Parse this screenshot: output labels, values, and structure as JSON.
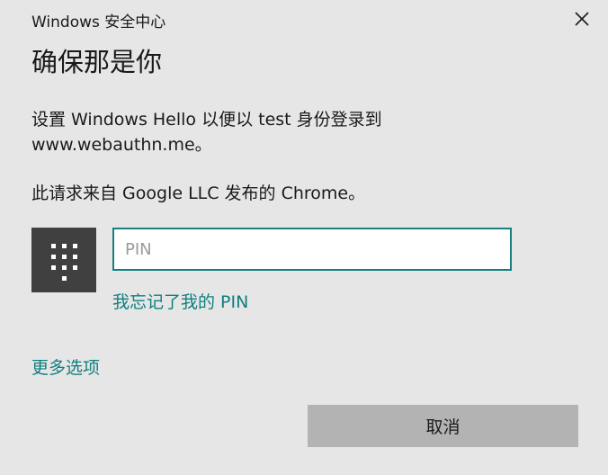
{
  "window": {
    "title": "Windows 安全中心",
    "close_icon": "close-icon"
  },
  "dialog": {
    "heading": "确保那是你",
    "message": "设置 Windows Hello 以便以 test 身份登录到 www.webauthn.me。",
    "requester": "此请求来自 Google LLC 发布的 Chrome。"
  },
  "pin": {
    "icon": "keypad-icon",
    "placeholder": "PIN",
    "value": "",
    "forgot_label": "我忘记了我的 PIN"
  },
  "footer": {
    "more_options_label": "更多选项",
    "cancel_label": "取消"
  },
  "colors": {
    "background": "#e6e6e6",
    "accent": "#0f7f80",
    "tile": "#404040",
    "button": "#b3b3b3"
  }
}
